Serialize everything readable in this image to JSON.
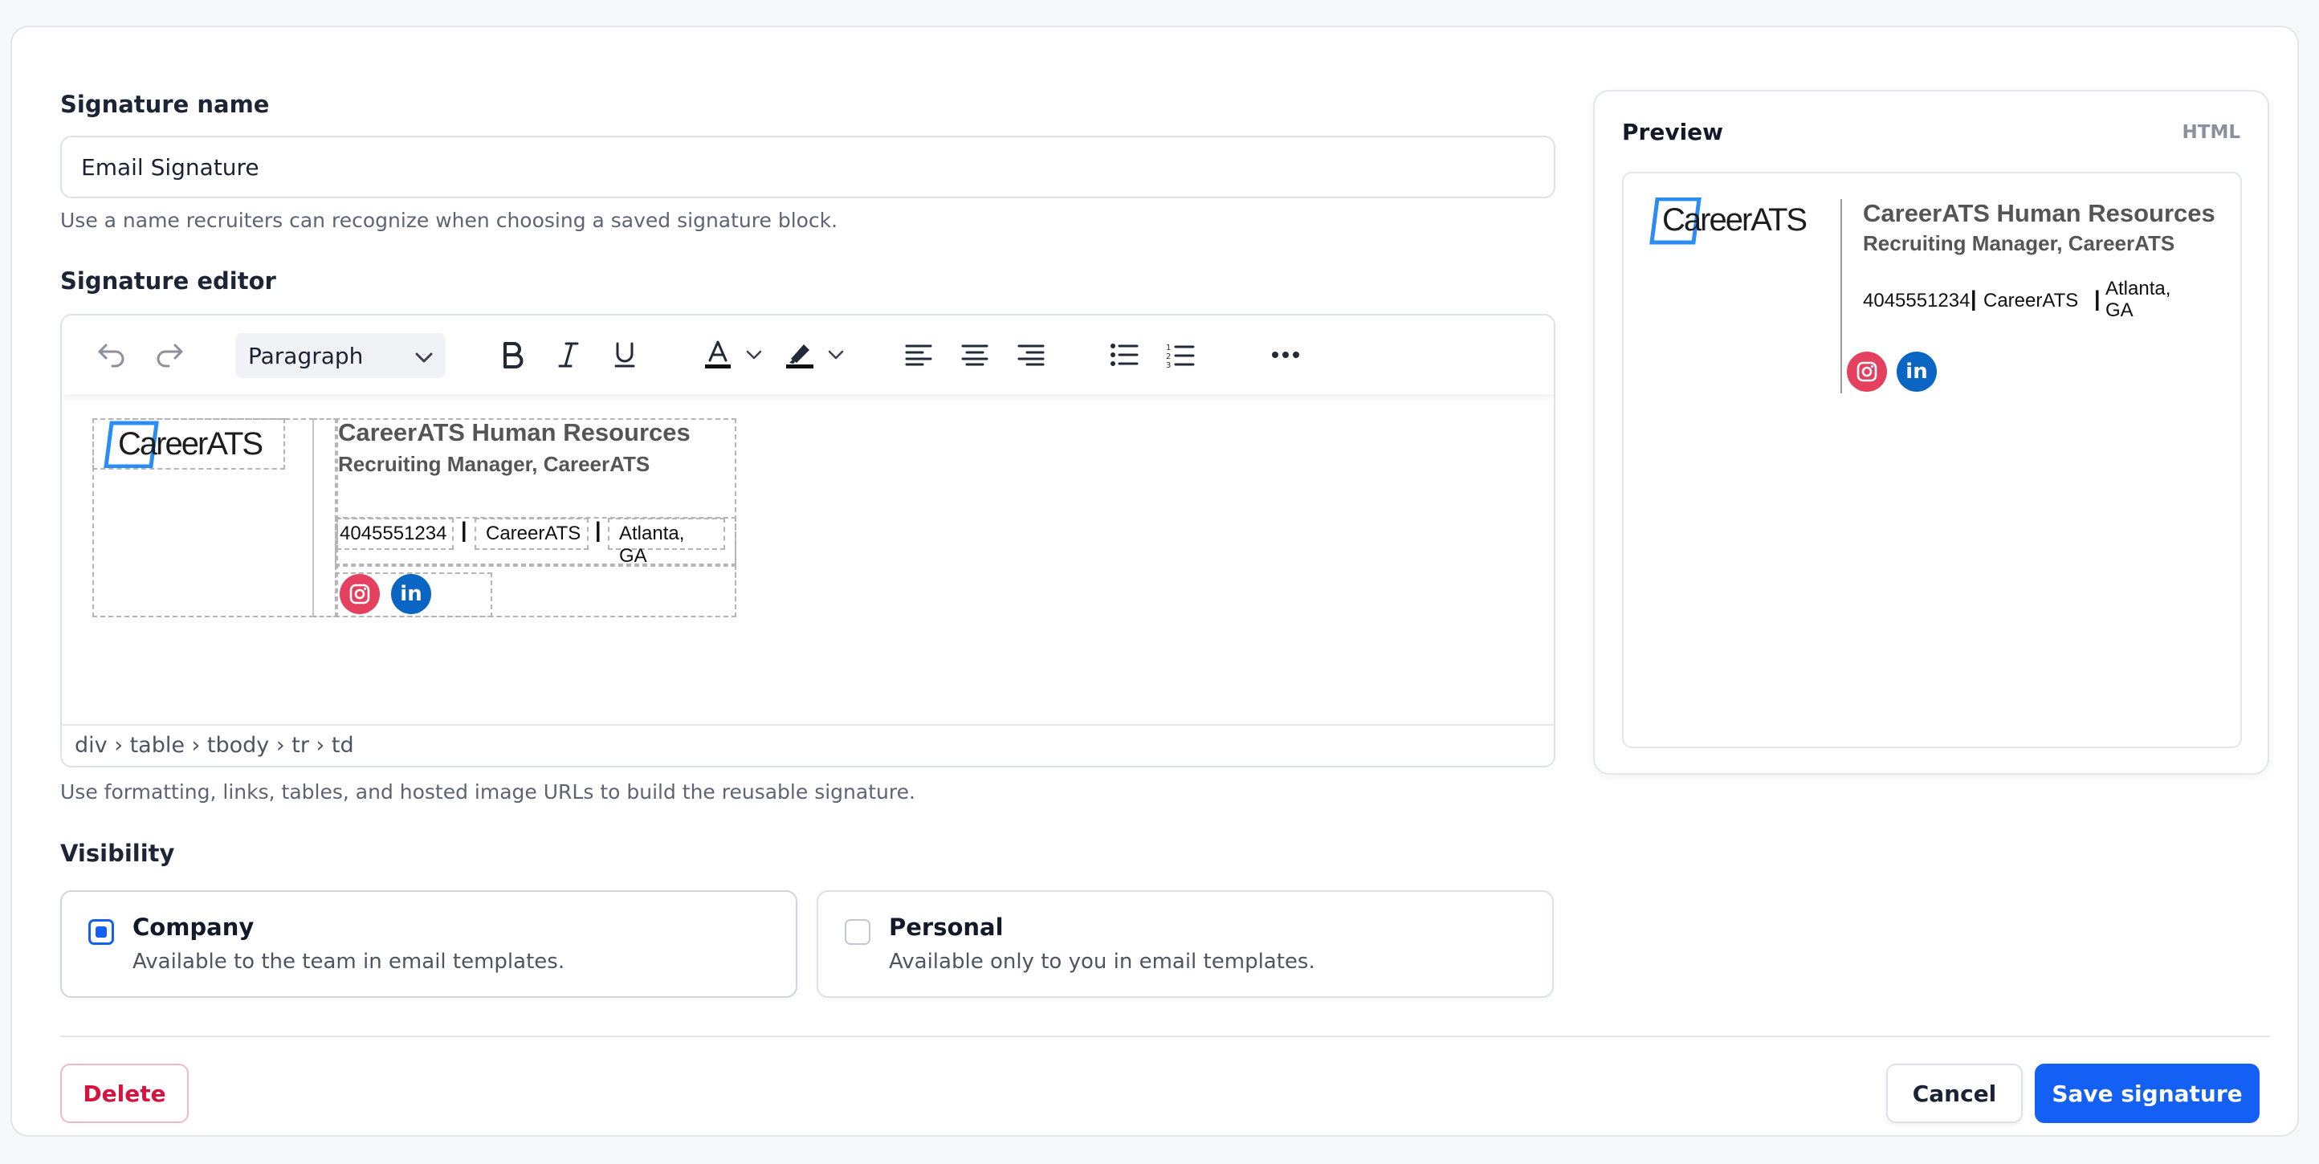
{
  "form": {
    "name_label": "Signature name",
    "name_value": "Email Signature",
    "name_help": "Use a name recruiters can recognize when choosing a saved signature block.",
    "editor_label": "Signature editor",
    "editor_help": "Use formatting, links, tables, and hosted image URLs to build the reusable signature.",
    "visibility_label": "Visibility"
  },
  "toolbar": {
    "block_format": "Paragraph"
  },
  "editor": {
    "path": "div › table › tbody › tr › td"
  },
  "signature": {
    "logo_text": "CareerATS",
    "name": "CareerATS Human Resources",
    "title": "Recruiting Manager, CareerATS",
    "phone": "4045551234",
    "company": "CareerATS",
    "location": "Atlanta, GA",
    "location_line1": "Atlanta,",
    "location_line2": "GA",
    "separator": "|"
  },
  "preview": {
    "title": "Preview",
    "mode": "HTML"
  },
  "visibility": {
    "options": [
      {
        "title": "Company",
        "desc": "Available to the team in email templates.",
        "selected": true
      },
      {
        "title": "Personal",
        "desc": "Available only to you in email templates.",
        "selected": false
      }
    ]
  },
  "actions": {
    "delete": "Delete",
    "cancel": "Cancel",
    "save": "Save signature"
  },
  "colors": {
    "primary": "#1560f4",
    "danger": "#d6123e",
    "instagram": "#e4405f",
    "linkedin": "#0a66c2",
    "logo_accent": "#2b8df3"
  },
  "icons": [
    "undo-icon",
    "redo-icon",
    "bold-icon",
    "italic-icon",
    "underline-icon",
    "text-color-icon",
    "highlight-icon",
    "align-left-icon",
    "align-center-icon",
    "align-right-icon",
    "bullet-list-icon",
    "numbered-list-icon",
    "more-icon",
    "instagram-icon",
    "linkedin-icon"
  ]
}
